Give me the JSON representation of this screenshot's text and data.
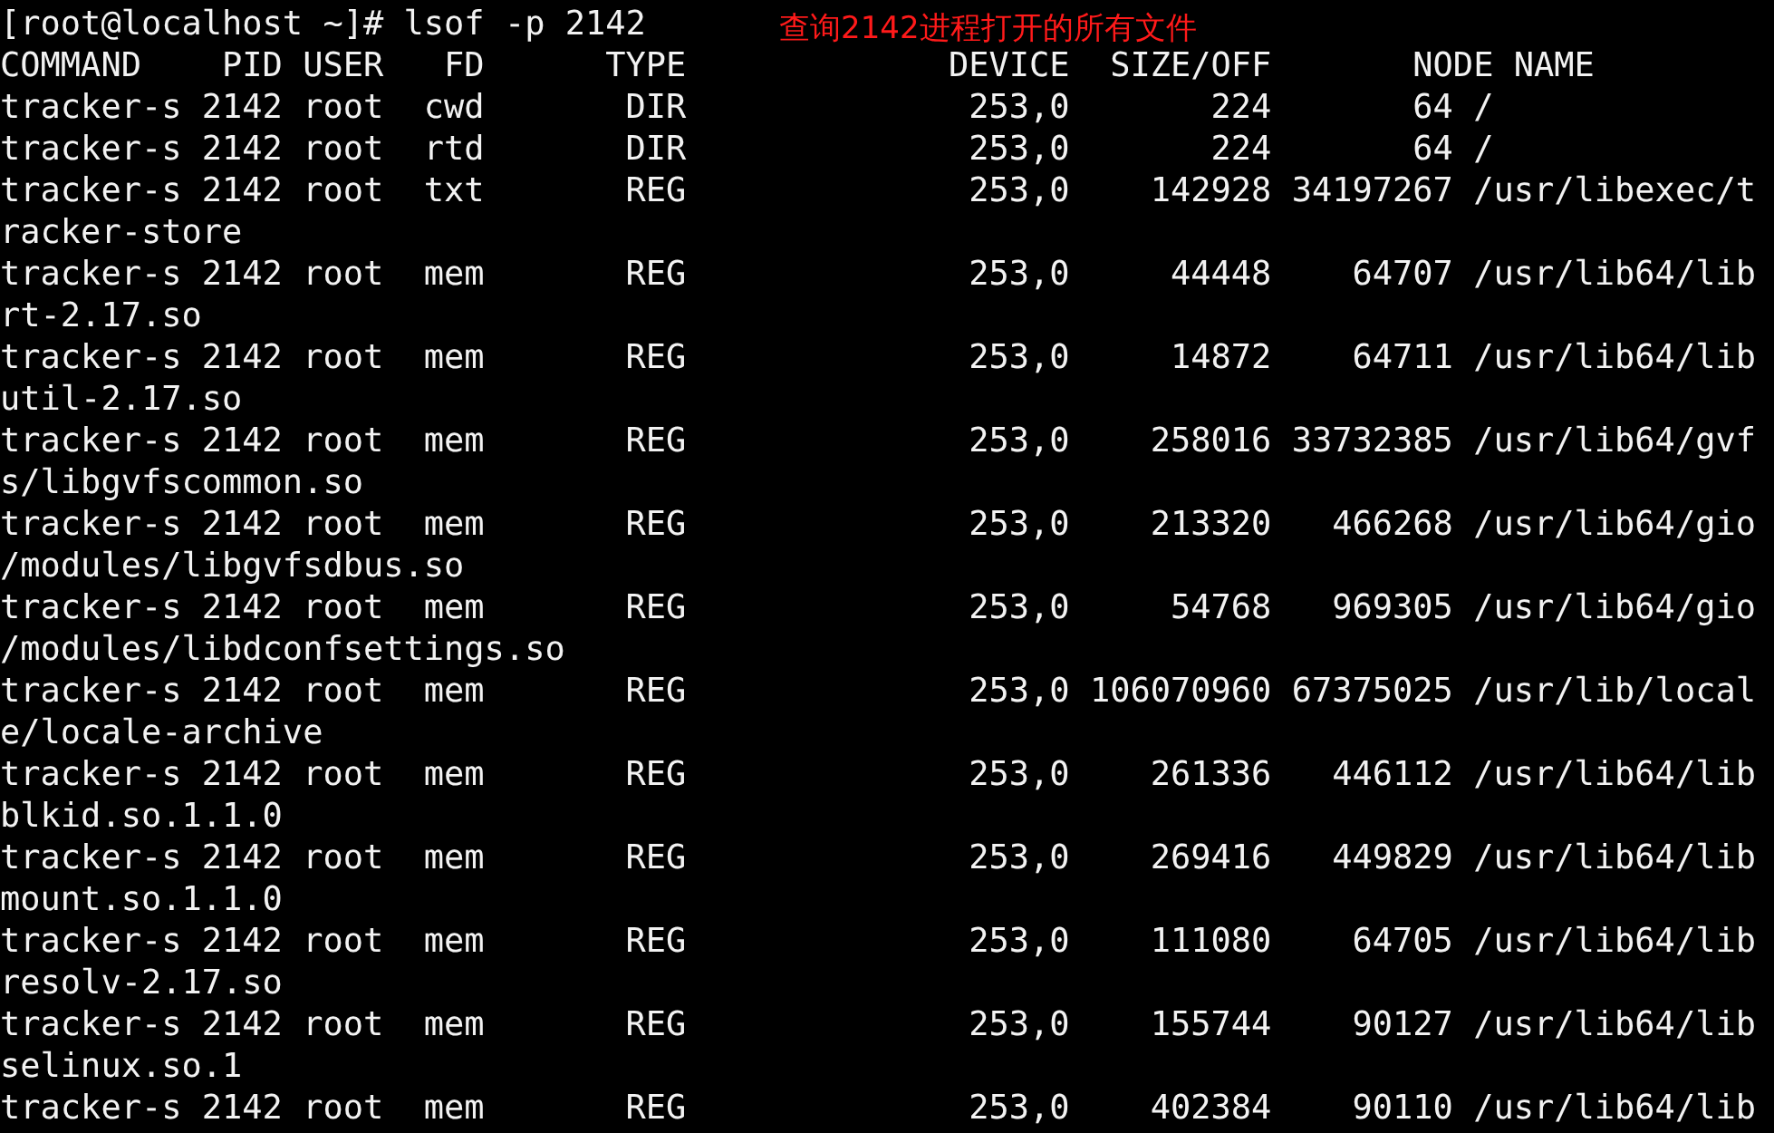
{
  "prompt": "[root@localhost ~]# lsof -p 2142",
  "annotation": "查询2142进程打开的所有文件",
  "header": "COMMAND    PID USER   FD      TYPE             DEVICE  SIZE/OFF       NODE NAME",
  "lines": [
    "tracker-s 2142 root  cwd       DIR              253,0       224       64 /",
    "tracker-s 2142 root  rtd       DIR              253,0       224       64 /",
    "tracker-s 2142 root  txt       REG              253,0    142928 34197267 /usr/libexec/t",
    "racker-store",
    "tracker-s 2142 root  mem       REG              253,0     44448    64707 /usr/lib64/lib",
    "rt-2.17.so",
    "tracker-s 2142 root  mem       REG              253,0     14872    64711 /usr/lib64/lib",
    "util-2.17.so",
    "tracker-s 2142 root  mem       REG              253,0    258016 33732385 /usr/lib64/gvf",
    "s/libgvfscommon.so",
    "tracker-s 2142 root  mem       REG              253,0    213320   466268 /usr/lib64/gio",
    "/modules/libgvfsdbus.so",
    "tracker-s 2142 root  mem       REG              253,0     54768   969305 /usr/lib64/gio",
    "/modules/libdconfsettings.so",
    "tracker-s 2142 root  mem       REG              253,0 106070960 67375025 /usr/lib/local",
    "e/locale-archive",
    "tracker-s 2142 root  mem       REG              253,0    261336   446112 /usr/lib64/lib",
    "blkid.so.1.1.0",
    "tracker-s 2142 root  mem       REG              253,0    269416   449829 /usr/lib64/lib",
    "mount.so.1.1.0",
    "tracker-s 2142 root  mem       REG              253,0    111080    64705 /usr/lib64/lib",
    "resolv-2.17.so",
    "tracker-s 2142 root  mem       REG              253,0    155744    90127 /usr/lib64/lib",
    "selinux.so.1",
    "tracker-s 2142 root  mem       REG              253,0    402384    90110 /usr/lib64/lib"
  ]
}
